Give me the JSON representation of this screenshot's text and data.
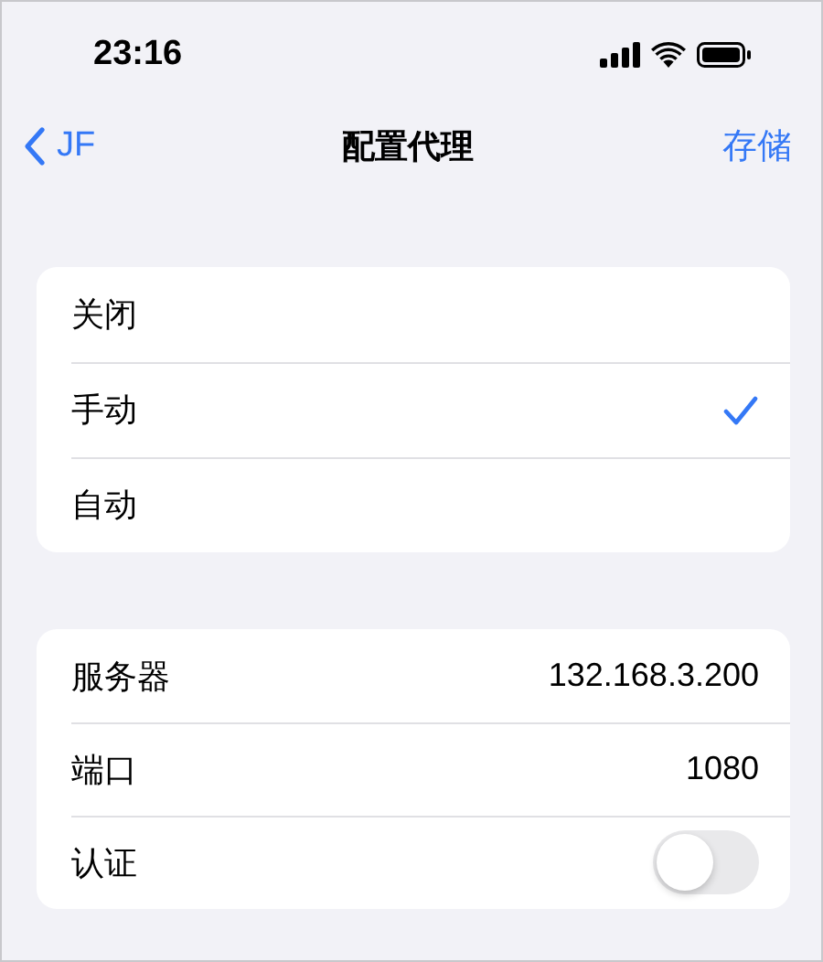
{
  "status_bar": {
    "time": "23:16"
  },
  "nav": {
    "back": "JF",
    "title": "配置代理",
    "action": "存储"
  },
  "proxy_modes": [
    {
      "label": "关闭",
      "selected": false
    },
    {
      "label": "手动",
      "selected": true
    },
    {
      "label": "自动",
      "selected": false
    }
  ],
  "settings": [
    {
      "kind": "value",
      "label": "服务器",
      "value": "132.168.3.200"
    },
    {
      "kind": "value",
      "label": "端口",
      "value": "1080"
    },
    {
      "kind": "toggle",
      "label": "认证",
      "on": false
    }
  ]
}
